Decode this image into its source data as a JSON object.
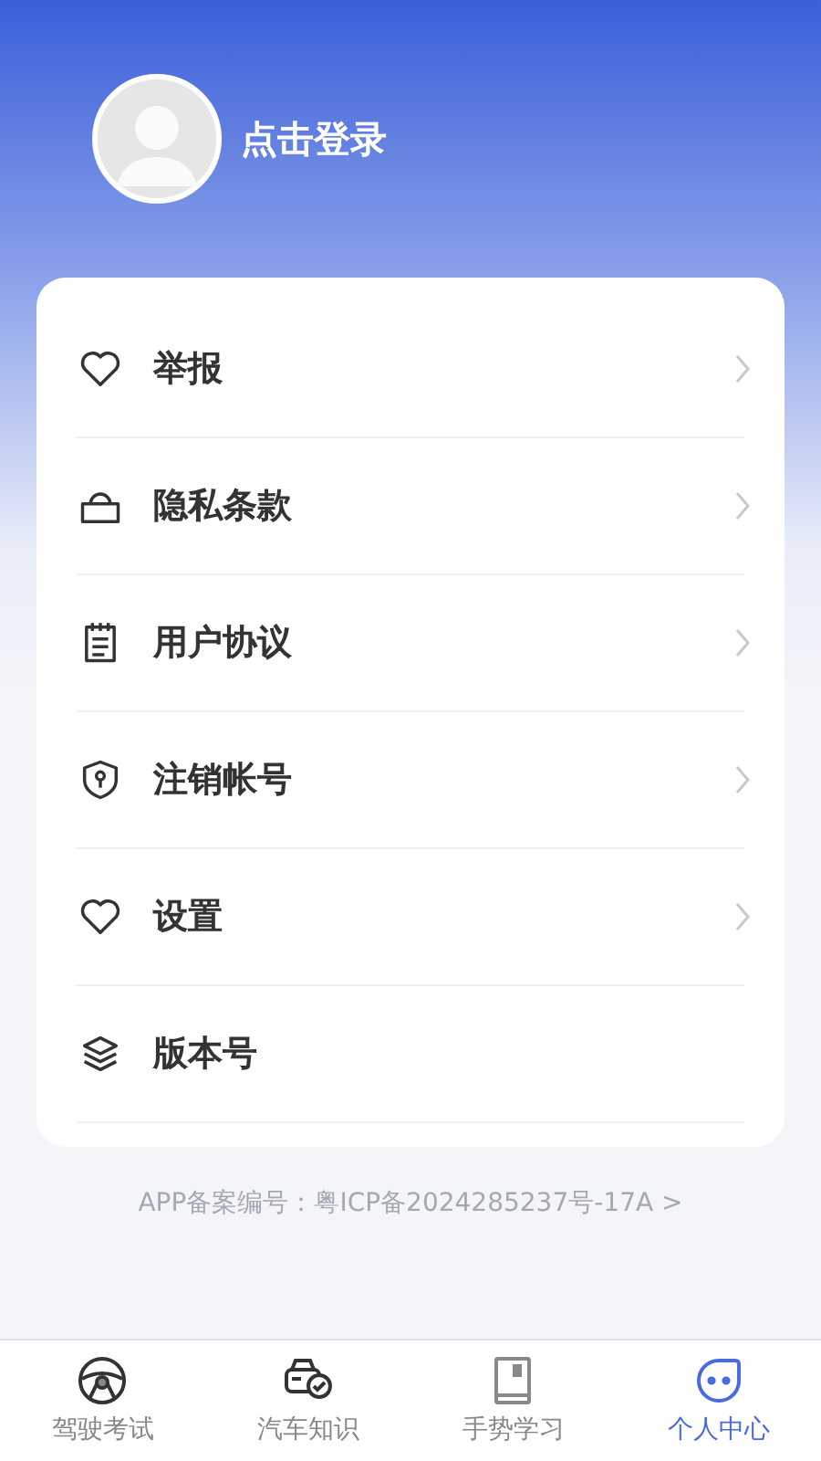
{
  "profile": {
    "login_label": "点击登录"
  },
  "menu": [
    {
      "label": "举报",
      "kind": "heart",
      "arrow": true
    },
    {
      "label": "隐私条款",
      "kind": "lock",
      "arrow": true
    },
    {
      "label": "用户协议",
      "kind": "notepad",
      "arrow": true
    },
    {
      "label": "注销帐号",
      "kind": "shield",
      "arrow": true
    },
    {
      "label": "设置",
      "kind": "heart",
      "arrow": true
    },
    {
      "label": "版本号",
      "kind": "layers",
      "arrow": false
    }
  ],
  "footer": {
    "record": "APP备案编号：粤ICP备2024285237号-17A >"
  },
  "tabs": [
    {
      "label": "驾驶考试",
      "kind": "wheel",
      "selected": false
    },
    {
      "label": "汽车知识",
      "kind": "car",
      "selected": false
    },
    {
      "label": "手势学习",
      "kind": "book",
      "selected": false
    },
    {
      "label": "个人中心",
      "kind": "face",
      "selected": true
    }
  ]
}
